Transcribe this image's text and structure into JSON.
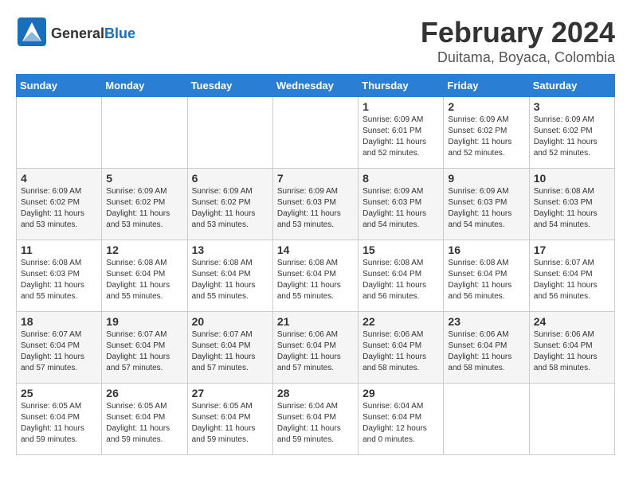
{
  "header": {
    "logo_general": "General",
    "logo_blue": "Blue",
    "title": "February 2024",
    "subtitle": "Duitama, Boyaca, Colombia"
  },
  "days_of_week": [
    "Sunday",
    "Monday",
    "Tuesday",
    "Wednesday",
    "Thursday",
    "Friday",
    "Saturday"
  ],
  "weeks": [
    [
      {
        "day": "",
        "info": ""
      },
      {
        "day": "",
        "info": ""
      },
      {
        "day": "",
        "info": ""
      },
      {
        "day": "",
        "info": ""
      },
      {
        "day": "1",
        "info": "Sunrise: 6:09 AM\nSunset: 6:01 PM\nDaylight: 11 hours\nand 52 minutes."
      },
      {
        "day": "2",
        "info": "Sunrise: 6:09 AM\nSunset: 6:02 PM\nDaylight: 11 hours\nand 52 minutes."
      },
      {
        "day": "3",
        "info": "Sunrise: 6:09 AM\nSunset: 6:02 PM\nDaylight: 11 hours\nand 52 minutes."
      }
    ],
    [
      {
        "day": "4",
        "info": "Sunrise: 6:09 AM\nSunset: 6:02 PM\nDaylight: 11 hours\nand 53 minutes."
      },
      {
        "day": "5",
        "info": "Sunrise: 6:09 AM\nSunset: 6:02 PM\nDaylight: 11 hours\nand 53 minutes."
      },
      {
        "day": "6",
        "info": "Sunrise: 6:09 AM\nSunset: 6:02 PM\nDaylight: 11 hours\nand 53 minutes."
      },
      {
        "day": "7",
        "info": "Sunrise: 6:09 AM\nSunset: 6:03 PM\nDaylight: 11 hours\nand 53 minutes."
      },
      {
        "day": "8",
        "info": "Sunrise: 6:09 AM\nSunset: 6:03 PM\nDaylight: 11 hours\nand 54 minutes."
      },
      {
        "day": "9",
        "info": "Sunrise: 6:09 AM\nSunset: 6:03 PM\nDaylight: 11 hours\nand 54 minutes."
      },
      {
        "day": "10",
        "info": "Sunrise: 6:08 AM\nSunset: 6:03 PM\nDaylight: 11 hours\nand 54 minutes."
      }
    ],
    [
      {
        "day": "11",
        "info": "Sunrise: 6:08 AM\nSunset: 6:03 PM\nDaylight: 11 hours\nand 55 minutes."
      },
      {
        "day": "12",
        "info": "Sunrise: 6:08 AM\nSunset: 6:04 PM\nDaylight: 11 hours\nand 55 minutes."
      },
      {
        "day": "13",
        "info": "Sunrise: 6:08 AM\nSunset: 6:04 PM\nDaylight: 11 hours\nand 55 minutes."
      },
      {
        "day": "14",
        "info": "Sunrise: 6:08 AM\nSunset: 6:04 PM\nDaylight: 11 hours\nand 55 minutes."
      },
      {
        "day": "15",
        "info": "Sunrise: 6:08 AM\nSunset: 6:04 PM\nDaylight: 11 hours\nand 56 minutes."
      },
      {
        "day": "16",
        "info": "Sunrise: 6:08 AM\nSunset: 6:04 PM\nDaylight: 11 hours\nand 56 minutes."
      },
      {
        "day": "17",
        "info": "Sunrise: 6:07 AM\nSunset: 6:04 PM\nDaylight: 11 hours\nand 56 minutes."
      }
    ],
    [
      {
        "day": "18",
        "info": "Sunrise: 6:07 AM\nSunset: 6:04 PM\nDaylight: 11 hours\nand 57 minutes."
      },
      {
        "day": "19",
        "info": "Sunrise: 6:07 AM\nSunset: 6:04 PM\nDaylight: 11 hours\nand 57 minutes."
      },
      {
        "day": "20",
        "info": "Sunrise: 6:07 AM\nSunset: 6:04 PM\nDaylight: 11 hours\nand 57 minutes."
      },
      {
        "day": "21",
        "info": "Sunrise: 6:06 AM\nSunset: 6:04 PM\nDaylight: 11 hours\nand 57 minutes."
      },
      {
        "day": "22",
        "info": "Sunrise: 6:06 AM\nSunset: 6:04 PM\nDaylight: 11 hours\nand 58 minutes."
      },
      {
        "day": "23",
        "info": "Sunrise: 6:06 AM\nSunset: 6:04 PM\nDaylight: 11 hours\nand 58 minutes."
      },
      {
        "day": "24",
        "info": "Sunrise: 6:06 AM\nSunset: 6:04 PM\nDaylight: 11 hours\nand 58 minutes."
      }
    ],
    [
      {
        "day": "25",
        "info": "Sunrise: 6:05 AM\nSunset: 6:04 PM\nDaylight: 11 hours\nand 59 minutes."
      },
      {
        "day": "26",
        "info": "Sunrise: 6:05 AM\nSunset: 6:04 PM\nDaylight: 11 hours\nand 59 minutes."
      },
      {
        "day": "27",
        "info": "Sunrise: 6:05 AM\nSunset: 6:04 PM\nDaylight: 11 hours\nand 59 minutes."
      },
      {
        "day": "28",
        "info": "Sunrise: 6:04 AM\nSunset: 6:04 PM\nDaylight: 11 hours\nand 59 minutes."
      },
      {
        "day": "29",
        "info": "Sunrise: 6:04 AM\nSunset: 6:04 PM\nDaylight: 12 hours\nand 0 minutes."
      },
      {
        "day": "",
        "info": ""
      },
      {
        "day": "",
        "info": ""
      }
    ]
  ]
}
